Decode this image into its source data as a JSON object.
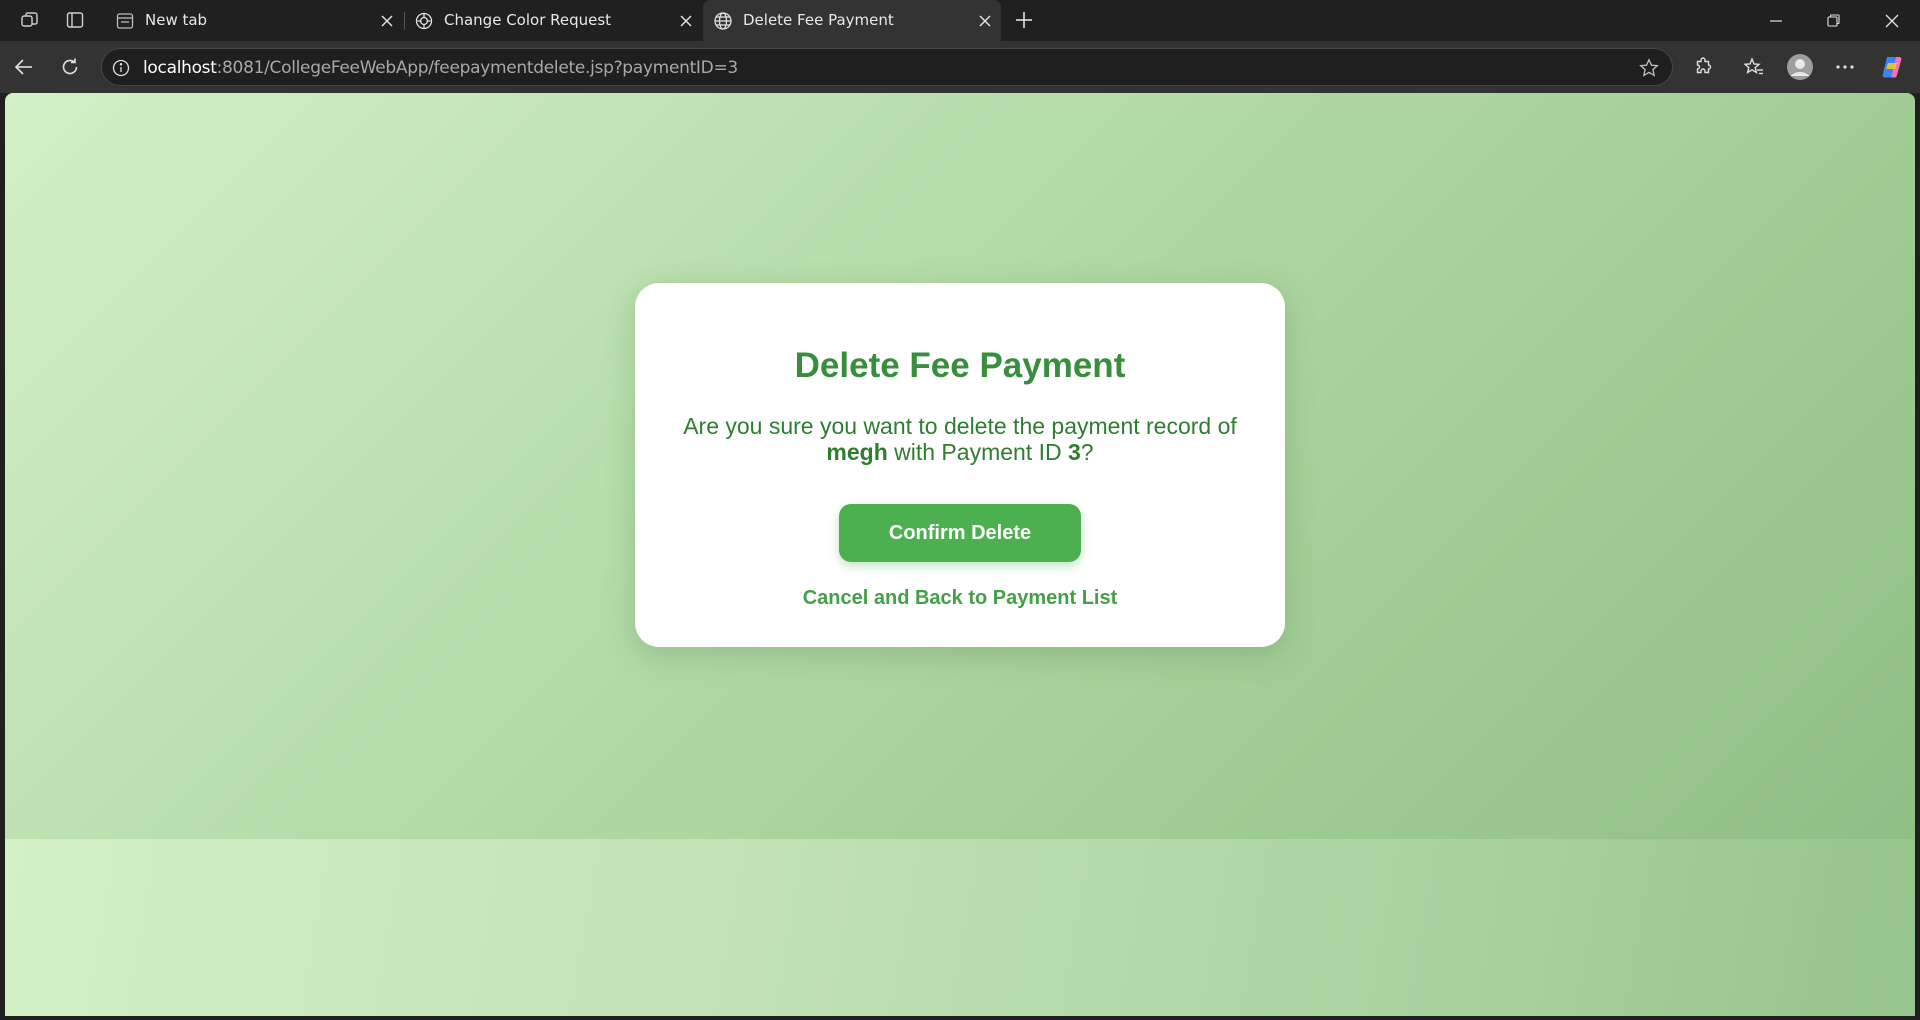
{
  "browser": {
    "tabs": [
      {
        "title": "New tab",
        "icon": "new-tab-icon",
        "active": false
      },
      {
        "title": "Change Color Request",
        "icon": "chatgpt-icon",
        "active": false
      },
      {
        "title": "Delete Fee Payment",
        "icon": "globe-icon",
        "active": true
      }
    ],
    "address": {
      "host": "localhost",
      "rest": ":8081/CollegeFeeWebApp/feepaymentdelete.jsp?paymentID=3"
    }
  },
  "page": {
    "heading": "Delete Fee Payment",
    "message_prefix": "Are you sure you want to delete the payment record of",
    "student_name": "megh",
    "message_middle": "with Payment ID",
    "payment_id": "3",
    "message_suffix": "?",
    "confirm_label": "Confirm Delete",
    "cancel_label": "Cancel and Back to Payment List"
  },
  "colors": {
    "primary_green": "#4caf50",
    "heading_green": "#388e3c",
    "text_green": "#2e7d32",
    "link_green": "#43a047",
    "background_light": "#d2f1c6",
    "background_dark": "#8fbf86"
  }
}
